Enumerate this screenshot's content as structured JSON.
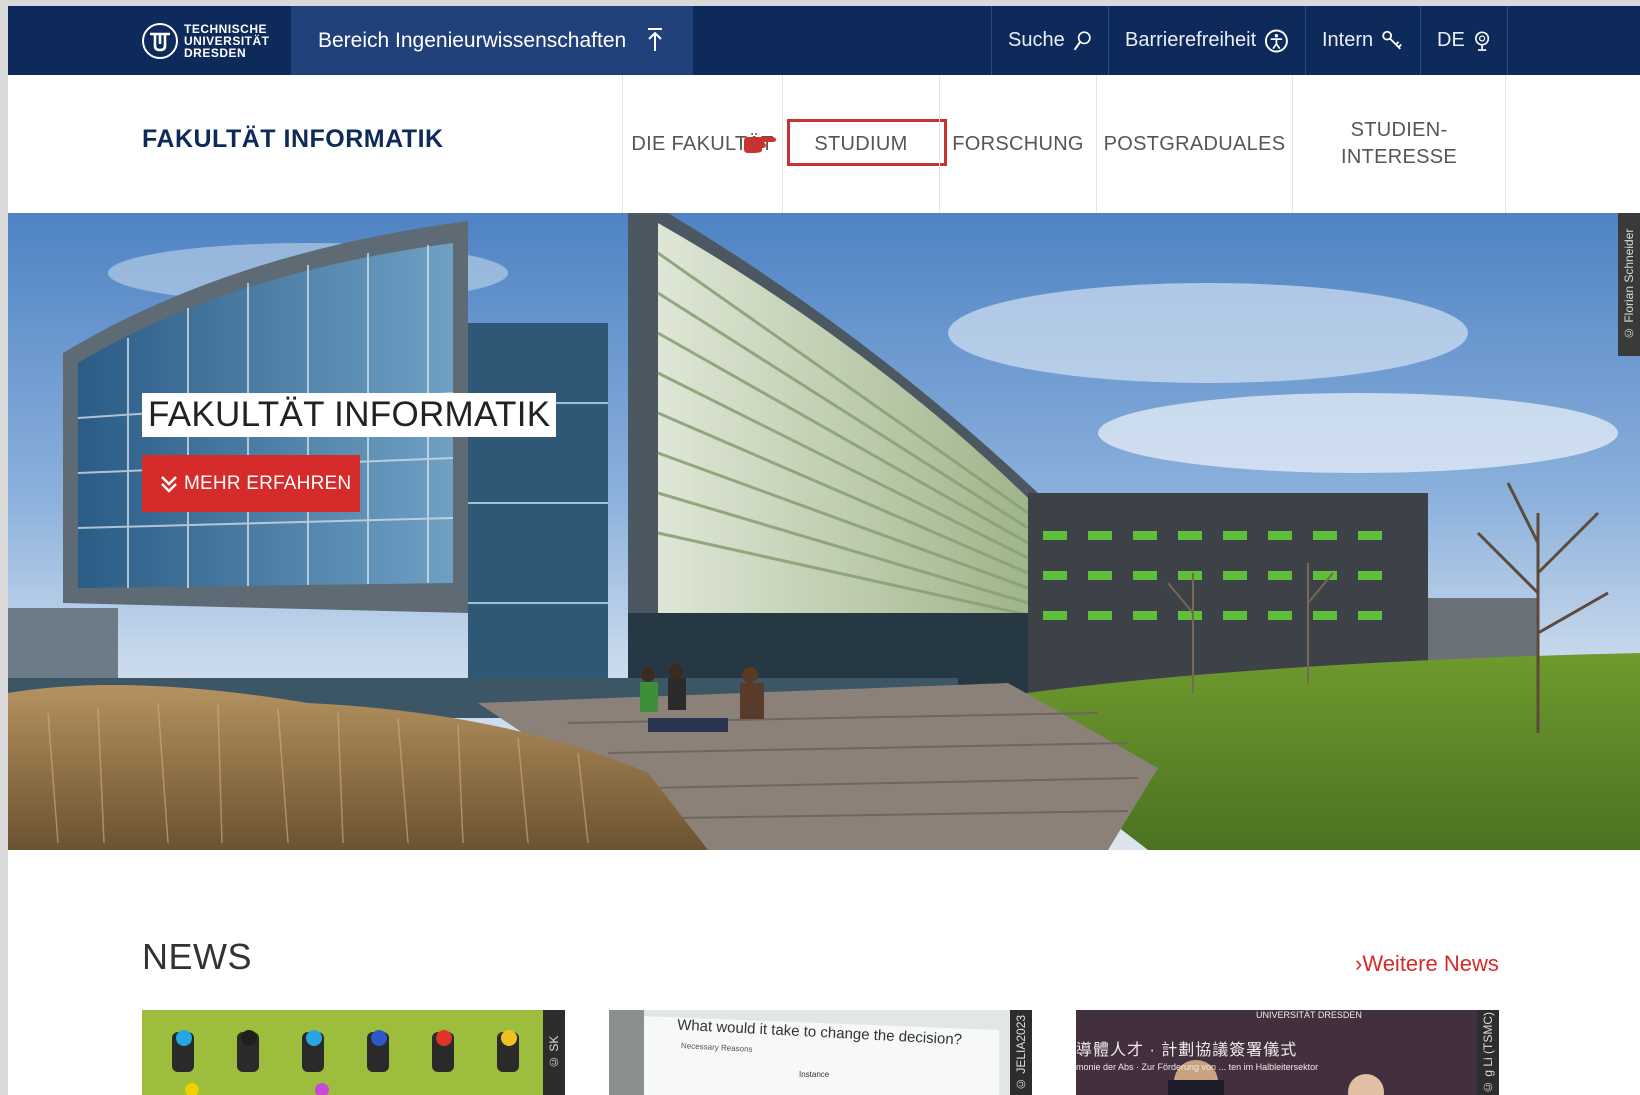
{
  "topbar": {
    "logo_lines": [
      "TECHNISCHE",
      "UNIVERSITÄT",
      "DRESDEN"
    ],
    "bereich": "Bereich Ingenieurwissenschaften",
    "links": [
      {
        "label": "Suche",
        "icon": "search-icon"
      },
      {
        "label": "Barrierefreiheit",
        "icon": "accessibility-icon"
      },
      {
        "label": "Intern",
        "icon": "key-icon"
      },
      {
        "label": "DE",
        "icon": "globe-icon"
      }
    ],
    "bg_color": "#0e2a5a",
    "bereich_color": "#21417a"
  },
  "header": {
    "title": "FAKULTÄT INFORMATIK",
    "nav": [
      "DIE FAKULTÄT",
      "STUDIUM",
      "FORSCHUNG",
      "POSTGRADUALES",
      "STUDIEN-",
      "INTERESSE"
    ],
    "highlighted": "STUDIUM"
  },
  "hero": {
    "title": "FAKULTÄT INFORMATIK",
    "button": "MEHR ERFAHREN",
    "credit": "© Florian Schneider",
    "button_color": "#d52b2b"
  },
  "news": {
    "title": "NEWS",
    "more": "Weitere News",
    "cards": [
      {
        "tag": "© SK"
      },
      {
        "tag": "© JELIA2023",
        "heading": "What would it take to change the decision?",
        "subheading": "Necessary Reasons",
        "instance": "Instance"
      },
      {
        "tag": "© g Li (TSMC)",
        "line1": "導體人才 · 計劃協議簽署儀式",
        "line2": "monie der Abs · Zur Förderung von ... ten im Halbleitersektor",
        "logo": "UNIVERSITÄT DRESDEN"
      }
    ]
  }
}
